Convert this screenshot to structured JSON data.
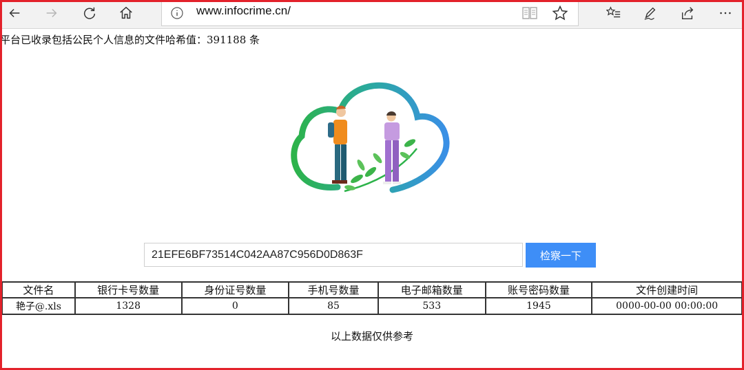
{
  "browser": {
    "url": "www.infocrime.cn/"
  },
  "page": {
    "count_line": "平台已收录包括公民个人信息的文件哈希值：391188 条",
    "search": {
      "value": "21EFE6BF73514C042AA87C956D0D863F",
      "button_label": "检察一下"
    },
    "table": {
      "headers": [
        "文件名",
        "银行卡号数量",
        "身份证号数量",
        "手机号数量",
        "电子邮箱数量",
        "账号密码数量",
        "文件创建时间"
      ],
      "rows": [
        [
          "艳子@.xls",
          "1328",
          "0",
          "85",
          "533",
          "1945",
          "0000-00-00 00:00:00"
        ]
      ]
    },
    "disclaimer": "以上数据仅供参考"
  },
  "colors": {
    "frame": "#e3222b",
    "button": "#3e8ef7",
    "cloud_start": "#2db34a",
    "cloud_end": "#3a8fe6"
  },
  "icons": [
    "back-arrow-icon",
    "forward-arrow-icon",
    "refresh-icon",
    "home-icon",
    "info-icon",
    "reading-view-icon",
    "favorite-star-icon",
    "favorites-list-icon",
    "pen-icon",
    "share-icon",
    "more-icon"
  ]
}
